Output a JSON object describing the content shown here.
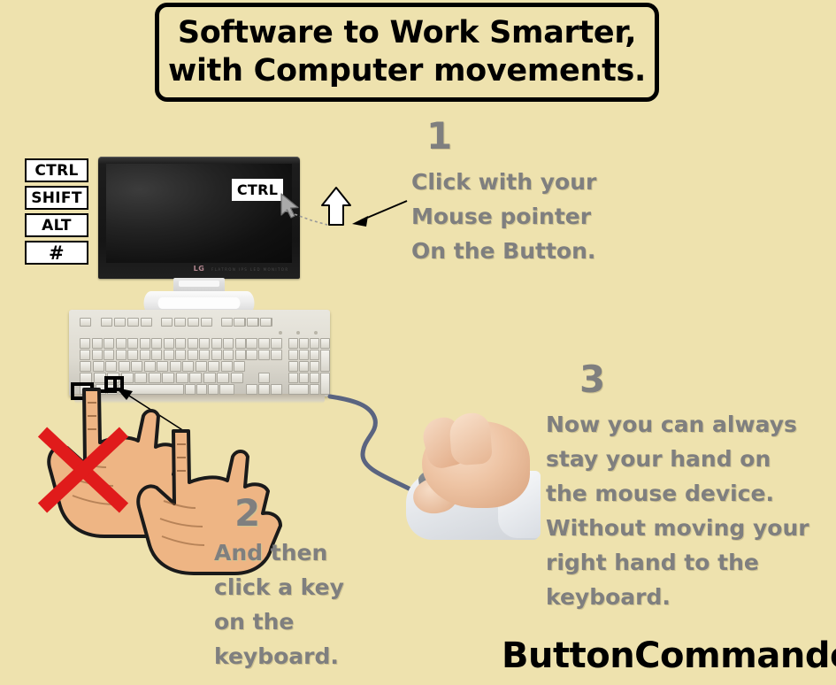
{
  "meta": {
    "background_color": "#eee2ae",
    "text_gray": "#7f7f7f",
    "text_black": "#000000"
  },
  "title": {
    "line1": "Software to Work Smarter,",
    "line2": "with Computer movements."
  },
  "key_chips": [
    {
      "label": "CTRL"
    },
    {
      "label": "SHIFT"
    },
    {
      "label": "ALT"
    },
    {
      "label": "#"
    }
  ],
  "monitor": {
    "brand_logo": "LG",
    "model_text": "FLATRON  IPS  LED  MONITOR",
    "onscreen_button_label": "CTRL"
  },
  "steps": [
    {
      "number": "1",
      "lines": [
        "Click with your",
        "Mouse pointer",
        "On the Button."
      ]
    },
    {
      "number": "2",
      "lines": [
        "And then",
        "click a key",
        "on the",
        "keyboard."
      ]
    },
    {
      "number": "3",
      "lines": [
        "Now you can always",
        "stay your hand on",
        "the mouse device.",
        "Without moving your",
        "right hand to the",
        "keyboard."
      ]
    }
  ],
  "brand": {
    "name": "ButtonCommander"
  },
  "icons": {
    "mouse_cursor": "mouse-cursor-icon",
    "up_arrow": "up-arrow-icon",
    "pointer_arrow": "pointer-arrow-icon",
    "red_x": "red-x-icon",
    "hand_left": "hand-pointing-left-icon",
    "hand_right": "hand-pointing-right-icon",
    "mouse_device": "computer-mouse-icon",
    "keyboard": "keyboard-icon",
    "monitor": "monitor-icon"
  }
}
